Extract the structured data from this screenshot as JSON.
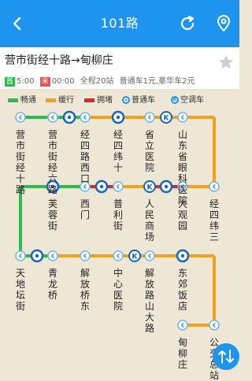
{
  "topbar": {
    "title": "101路",
    "bg": "#1d95ee",
    "left_icon": "back-icon",
    "right_icons": [
      "refresh-icon",
      "location-pin-icon"
    ]
  },
  "route": {
    "name": "营市街经十路→甸柳庄",
    "first_tag": "首",
    "first_time": "5:00",
    "last_tag": "末",
    "last_time": "00:00",
    "stops_info": "全程20站",
    "fare": "普通车1元,豪华车2元"
  },
  "legend": {
    "smooth": "畅通",
    "slow": "缓行",
    "jam": "拥堵",
    "bus": "普通车",
    "ac": "空调车",
    "colors": {
      "smooth": "#2dbb4f",
      "slow": "#f0a21b",
      "jam": "#e32424"
    }
  },
  "stations": [
    "营市街经十路",
    "营市街经六路",
    "经四路西口",
    "经四纬十",
    "省立医院",
    "山东省眼科医院",
    "经四纬三",
    "大观园",
    "人民商场",
    "普利街",
    "西门",
    "芙蓉街",
    "天地坛街",
    "青龙桥",
    "解放桥东",
    "中心医院",
    "解放路山大路",
    "东郊饭店",
    "甸柳庄",
    "公交总站"
  ]
}
